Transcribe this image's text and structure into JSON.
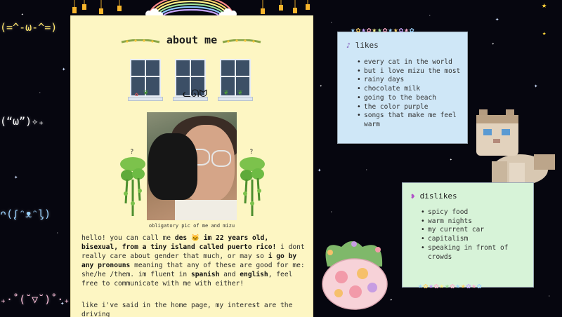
{
  "kaomoji": [
    {
      "text": "(=^-ω-^=)",
      "color": "#ffe66b"
    },
    {
      "text": "(“ω”)✧₊",
      "color": "#ffffff"
    },
    {
      "text": "ᴖ(ᶘᵔᴥᵔᶅ)",
      "color": "#9ad2ff"
    },
    {
      "text": "₊·˚(˘▽˘)˚·₊",
      "color": "#ffc0dc"
    }
  ],
  "about": {
    "title": "about me",
    "photo_alt": "photo of me and mizu",
    "caption": "obligatory pic of me and mizu",
    "question_mark": "?",
    "bio_1": "hello! you can call me ",
    "bio_name": "des",
    "bio_2": " im 22 years old, bisexual, from a tiny island called puerto rico!",
    "bio_3": " i dont really care about gender that much, or may so ",
    "bio_4": "i go by any pronouns",
    "bio_5": " meaning that any of these are good for me: she/he /them. im fluent in ",
    "bio_6": "spanish",
    "bio_7": " and ",
    "bio_8": "english",
    "bio_9": ", feel free to communicate with me with either!",
    "bio_more": "like i've said in the home page, my interest are the driving"
  },
  "likes": {
    "title": "likes",
    "items": [
      "every cat in the world",
      "but i love mizu the most",
      "rainy days",
      "chocolate milk",
      "going to the beach",
      "the color purple",
      "songs that make me feel warm"
    ]
  },
  "dislikes": {
    "title": "dislikes",
    "items": [
      "spicy food",
      "warm nights",
      "my current car",
      "capitalism",
      "speaking in front of crowds"
    ]
  },
  "colors": {
    "page_bg": "#06060f",
    "panel_bg": "#fdf6c3",
    "likes_bg": "#cfe7f7",
    "dislikes_bg": "#d7f3d8"
  }
}
